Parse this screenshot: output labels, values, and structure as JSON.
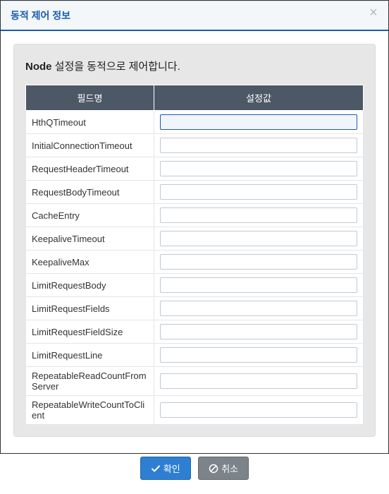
{
  "modal": {
    "title": "동적 제어 정보",
    "desc_bold": "Node",
    "desc_rest": " 설정을 동적으로 제어합니다.",
    "columns": {
      "name": "필드명",
      "value": "설정값"
    },
    "rows": [
      {
        "name": "HthQTimeout",
        "value": "",
        "focused": true
      },
      {
        "name": "InitialConnectionTimeout",
        "value": ""
      },
      {
        "name": "RequestHeaderTimeout",
        "value": ""
      },
      {
        "name": "RequestBodyTimeout",
        "value": ""
      },
      {
        "name": "CacheEntry",
        "value": ""
      },
      {
        "name": "KeepaliveTimeout",
        "value": ""
      },
      {
        "name": "KeepaliveMax",
        "value": ""
      },
      {
        "name": "LimitRequestBody",
        "value": ""
      },
      {
        "name": "LimitRequestFields",
        "value": ""
      },
      {
        "name": "LimitRequestFieldSize",
        "value": ""
      },
      {
        "name": "LimitRequestLine",
        "value": ""
      },
      {
        "name": "RepeatableReadCountFromServer",
        "value": ""
      },
      {
        "name": "RepeatableWriteCountToClient",
        "value": ""
      }
    ],
    "buttons": {
      "ok": "확인",
      "cancel": "취소"
    }
  }
}
